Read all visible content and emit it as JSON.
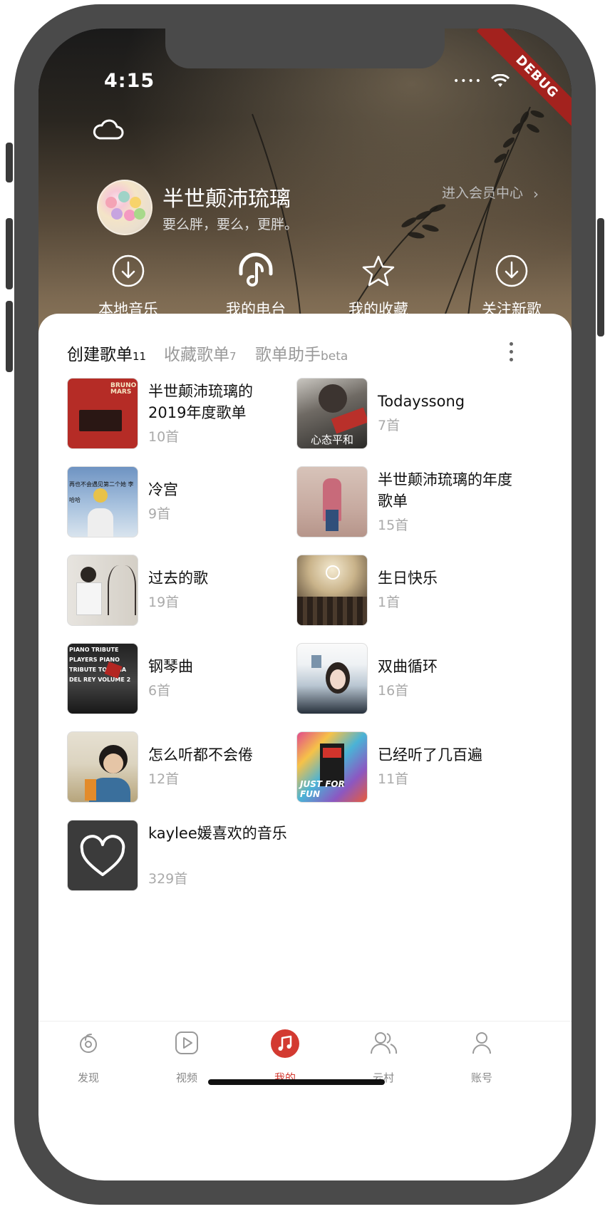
{
  "status": {
    "time": "4:15",
    "debug_label": "DEBUG"
  },
  "profile": {
    "name": "半世颠沛琉璃",
    "signature": "要么胖，要么，更胖。",
    "vip_label": "进入会员中心"
  },
  "quick_actions": [
    {
      "label": "本地音乐",
      "icon": "download-circle-icon"
    },
    {
      "label": "我的电台",
      "icon": "headphone-icon"
    },
    {
      "label": "我的收藏",
      "icon": "star-icon"
    },
    {
      "label": "关注新歌",
      "icon": "download-circle-icon"
    }
  ],
  "tabs": [
    {
      "label": "创建歌单",
      "count": "11",
      "active": true
    },
    {
      "label": "收藏歌单",
      "count": "7",
      "active": false
    },
    {
      "label": "歌单助手",
      "count": "beta",
      "active": false
    }
  ],
  "playlists": [
    {
      "title": "半世颠沛琉璃的2019年度歌单",
      "count": "10首",
      "cover_text": "BRUNO MARS"
    },
    {
      "title": "Todayssong",
      "count": "7首",
      "cover_text": "心态平和"
    },
    {
      "title": "冷宫",
      "count": "9首",
      "cover_text": "再也不会遇见第二个她 李哈哈"
    },
    {
      "title": "半世颠沛琉璃的年度歌单",
      "count": "15首",
      "cover_text": ""
    },
    {
      "title": "过去的歌",
      "count": "19首",
      "cover_text": ""
    },
    {
      "title": "生日快乐",
      "count": "1首",
      "cover_text": ""
    },
    {
      "title": "钢琴曲",
      "count": "6首",
      "cover_text": "PIANO TRIBUTE PLAYERS PIANO TRIBUTE TO LANA DEL REY VOLUME 2"
    },
    {
      "title": "双曲循环",
      "count": "16首",
      "cover_text": ""
    },
    {
      "title": "怎么听都不会倦",
      "count": "12首",
      "cover_text": ""
    },
    {
      "title": "已经听了几百遍",
      "count": "11首",
      "cover_text": "JUST FOR FUN"
    },
    {
      "title": "kaylee媛喜欢的音乐",
      "count": "329首",
      "cover_text": ""
    }
  ],
  "bottom_nav": [
    {
      "label": "发现",
      "active": false
    },
    {
      "label": "视频",
      "active": false
    },
    {
      "label": "我的",
      "active": true
    },
    {
      "label": "云村",
      "active": false
    },
    {
      "label": "账号",
      "active": false
    }
  ],
  "colors": {
    "accent": "#d33a31",
    "muted": "#aaaaaa",
    "text": "#111111"
  }
}
